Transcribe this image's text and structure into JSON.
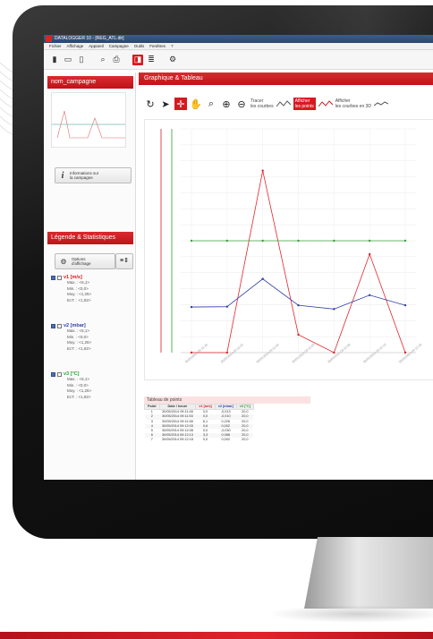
{
  "window": {
    "title": "DATALOGGER 10 - [REG_ATL.dlr]"
  },
  "menu": [
    "Fichier",
    "Affichage",
    "Appareil",
    "Campagne",
    "Outils",
    "Fenêtres",
    "?"
  ],
  "left": {
    "campaign_header": "nom_campagne",
    "info_button": [
      "Informations sur",
      "la campagne"
    ],
    "legend_header": "Légende & Statistiques",
    "options_button": [
      "Options",
      "d'affichage"
    ],
    "channels": [
      {
        "name": "v1 [m/s]",
        "color": "#d7191f",
        "stats": [
          "Max. : <6,1>",
          "Min. : <0,0>",
          "Moy. : <1,25>",
          "EcT. : <1,92>"
        ]
      },
      {
        "name": "v2 [mbar]",
        "color": "#2e3fa6",
        "stats": [
          "Max. : <6,1>",
          "Min. : <0,0>",
          "Moy. : <1,25>",
          "EcT. : <1,92>"
        ]
      },
      {
        "name": "v3 [°C]",
        "color": "#2f9e2f",
        "stats": [
          "Max. : <6,1>",
          "Min. : <0,0>",
          "Moy. : <1,25>",
          "EcT. : <1,92>"
        ]
      }
    ]
  },
  "main": {
    "header": "Graphique & Tableau",
    "tracer_label": [
      "Tracer",
      "les courbes"
    ],
    "afficher_points_label": [
      "Afficher",
      "les points"
    ],
    "afficher_3d_label": [
      "Afficher",
      "les courbes en 3D"
    ]
  },
  "chart_data": {
    "type": "line",
    "x": [
      "30/05/2014 09:11:48",
      "30/05/2014 09:11:53",
      "30/05/2014 09:11:58",
      "30/05/2014 09:12:03",
      "30/05/2014 09:12:08",
      "30/05/2014 09:12:13",
      "30/05/2014 09:12:18"
    ],
    "series": [
      {
        "name": "v1 [m/s]",
        "color": "#e0262d",
        "values": [
          0.0,
          0.0,
          6.1,
          0.6,
          0.0,
          3.3,
          0.0
        ]
      },
      {
        "name": "v2 [mbar]",
        "color": "#2e3fa6",
        "values": [
          -0.013,
          -0.01,
          0.226,
          0.002,
          -0.03,
          0.088,
          0.002
        ]
      },
      {
        "name": "v3 [°C]",
        "color": "#3aa23a",
        "values": [
          20.0,
          20.0,
          20.0,
          20.0,
          20.0,
          20.0,
          20.0
        ]
      }
    ],
    "grid": true
  },
  "table": {
    "title": "Tableau de points",
    "headers": [
      "Point",
      "Date / heure",
      "v1 [m/s]",
      "v2 [mbar]",
      "v3 [°C]"
    ],
    "rows": [
      [
        "1",
        "30/05/2014 09:11:48",
        "0,0",
        "-0,013",
        "20,0"
      ],
      [
        "2",
        "30/05/2014 09:11:53",
        "0,0",
        "-0,010",
        "20,0"
      ],
      [
        "3",
        "30/05/2014 09:11:58",
        "6,1",
        "0,226",
        "20,0"
      ],
      [
        "4",
        "30/05/2014 09:12:03",
        "0,6",
        "0,002",
        "20,0"
      ],
      [
        "5",
        "30/05/2014 09:12:08",
        "0,0",
        "-0,030",
        "20,0"
      ],
      [
        "6",
        "30/05/2014 09:12:13",
        "3,3",
        "0,088",
        "20,0"
      ],
      [
        "7",
        "30/05/2014 09:12:18",
        "0,0",
        "0,002",
        "20,0"
      ]
    ]
  },
  "accent_color": "#d7191f"
}
